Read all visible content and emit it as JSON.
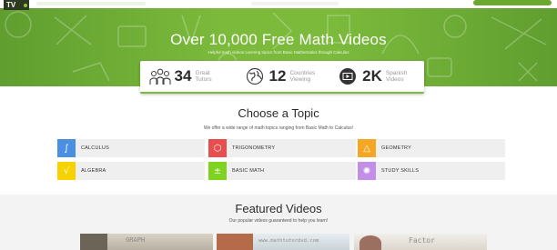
{
  "brand": {
    "logo_text": "TV"
  },
  "hero": {
    "title": "Over 10,000 Free Math Videos",
    "subtitle": "Helpful math videos covering topics from Basic Mathematics through Calculus",
    "accent": "#7cba3c"
  },
  "stats": [
    {
      "number": "34",
      "label": "Great Tutors",
      "icon": "tutors-icon"
    },
    {
      "number": "12",
      "label": "Countries Viewing",
      "icon": "globe-icon"
    },
    {
      "number": "2K",
      "label": "Spanish Videos",
      "icon": "video-play-icon"
    }
  ],
  "topics_section": {
    "title": "Choose a Topic",
    "subtitle": "We offer a wide range of math topics ranging from Basic Math to Calculus!",
    "items": [
      {
        "label": "CALCULUS",
        "icon": "integral-icon",
        "glyph": "∫",
        "color": "#4a90e2"
      },
      {
        "label": "TRIGONOMETRY",
        "icon": "cube-icon",
        "glyph": "⬡",
        "color": "#e94e4e"
      },
      {
        "label": "GEOMETRY",
        "icon": "compass-icon",
        "glyph": "△",
        "color": "#f5a623"
      },
      {
        "label": "ALGEBRA",
        "icon": "square-root-icon",
        "glyph": "√",
        "color": "#f8d200"
      },
      {
        "label": "BASIC MATH",
        "icon": "arithmetic-icon",
        "glyph": "±",
        "color": "#7ed321"
      },
      {
        "label": "STUDY SKILLS",
        "icon": "lightbulb-icon",
        "glyph": "✺",
        "color": "#c28ee8"
      }
    ]
  },
  "featured": {
    "title": "Featured Videos",
    "subtitle": "Our popular videos guaranteed to help you learn!",
    "videos": [
      {
        "visible_text": "GRAPH"
      },
      {
        "visible_text": "www.mathtutordvd.com"
      },
      {
        "visible_text": "Factor"
      }
    ]
  }
}
